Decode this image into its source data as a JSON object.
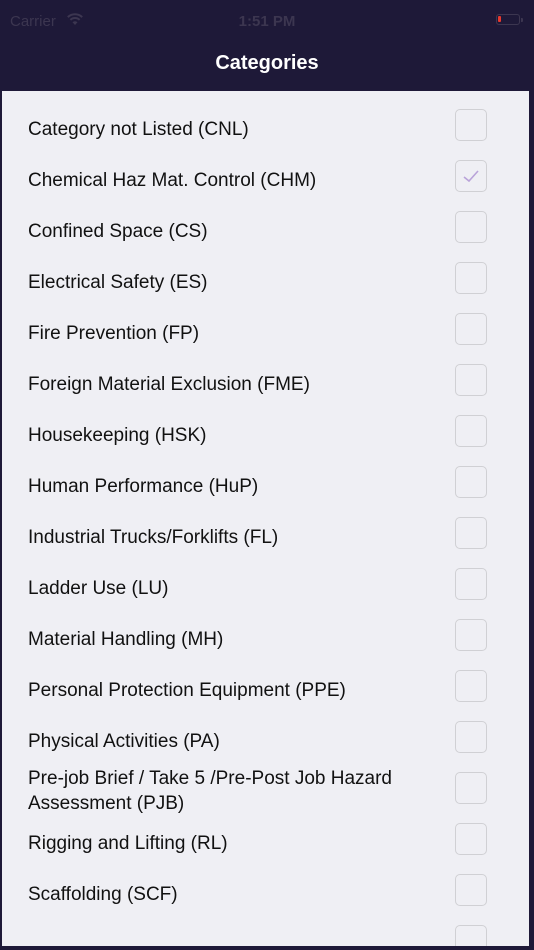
{
  "status_bar": {
    "carrier": "Carrier",
    "time": "1:51 PM",
    "battery_color": "#e8392e"
  },
  "nav": {
    "title": "Categories"
  },
  "accent_check_color": "#b9a3d9",
  "categories": [
    {
      "label": "Category not Listed (CNL)",
      "checked": false
    },
    {
      "label": "Chemical Haz Mat. Control (CHM)",
      "checked": true
    },
    {
      "label": "Confined Space (CS)",
      "checked": false
    },
    {
      "label": "Electrical Safety (ES)",
      "checked": false
    },
    {
      "label": "Fire Prevention (FP)",
      "checked": false
    },
    {
      "label": "Foreign Material Exclusion (FME)",
      "checked": false
    },
    {
      "label": "Housekeeping (HSK)",
      "checked": false
    },
    {
      "label": "Human Performance (HuP)",
      "checked": false
    },
    {
      "label": "Industrial Trucks/Forklifts (FL)",
      "checked": false
    },
    {
      "label": "Ladder Use (LU)",
      "checked": false
    },
    {
      "label": "Material Handling (MH)",
      "checked": false
    },
    {
      "label": "Personal Protection Equipment (PPE)",
      "checked": false
    },
    {
      "label": "Physical Activities (PA)",
      "checked": false
    },
    {
      "label": "Pre-job Brief / Take 5 /Pre-Post Job Hazard Assessment (PJB)",
      "checked": false
    },
    {
      "label": "Rigging and Lifting (RL)",
      "checked": false
    },
    {
      "label": "Scaffolding (SCF)",
      "checked": false
    }
  ]
}
